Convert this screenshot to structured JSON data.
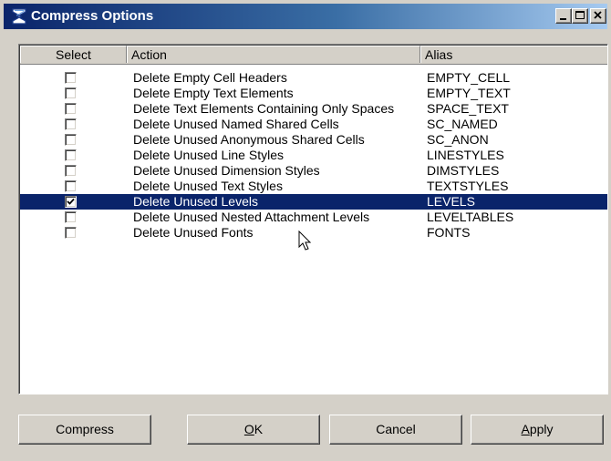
{
  "window": {
    "title": "Compress Options",
    "controls": [
      "minimize-icon",
      "maximize-icon",
      "close-icon"
    ]
  },
  "columns": {
    "select": "Select",
    "action": "Action",
    "alias": "Alias"
  },
  "rows": [
    {
      "checked": false,
      "selected": false,
      "action": "Delete Empty Cell Headers",
      "alias": "EMPTY_CELL"
    },
    {
      "checked": false,
      "selected": false,
      "action": "Delete Empty Text Elements",
      "alias": "EMPTY_TEXT"
    },
    {
      "checked": false,
      "selected": false,
      "action": "Delete Text Elements Containing Only Spaces",
      "alias": "SPACE_TEXT"
    },
    {
      "checked": false,
      "selected": false,
      "action": "Delete Unused Named Shared Cells",
      "alias": "SC_NAMED"
    },
    {
      "checked": false,
      "selected": false,
      "action": "Delete Unused Anonymous Shared Cells",
      "alias": "SC_ANON"
    },
    {
      "checked": false,
      "selected": false,
      "action": "Delete Unused Line Styles",
      "alias": "LINESTYLES"
    },
    {
      "checked": false,
      "selected": false,
      "action": "Delete Unused Dimension Styles",
      "alias": "DIMSTYLES"
    },
    {
      "checked": false,
      "selected": false,
      "action": "Delete Unused Text Styles",
      "alias": "TEXTSTYLES"
    },
    {
      "checked": true,
      "selected": true,
      "action": "Delete Unused Levels",
      "alias": "LEVELS"
    },
    {
      "checked": false,
      "selected": false,
      "action": "Delete Unused Nested Attachment Levels",
      "alias": "LEVELTABLES"
    },
    {
      "checked": false,
      "selected": false,
      "action": "Delete Unused Fonts",
      "alias": "FONTS"
    }
  ],
  "buttons": {
    "compress": "Compress",
    "ok_mnemonic": "O",
    "ok_rest": "K",
    "cancel": "Cancel",
    "apply_mnemonic": "A",
    "apply_rest": "pply"
  },
  "colors": {
    "selection": "#0a246a",
    "title_gradient_start": "#0a246a",
    "title_gradient_end": "#a6caf0",
    "face": "#d4d0c8"
  }
}
